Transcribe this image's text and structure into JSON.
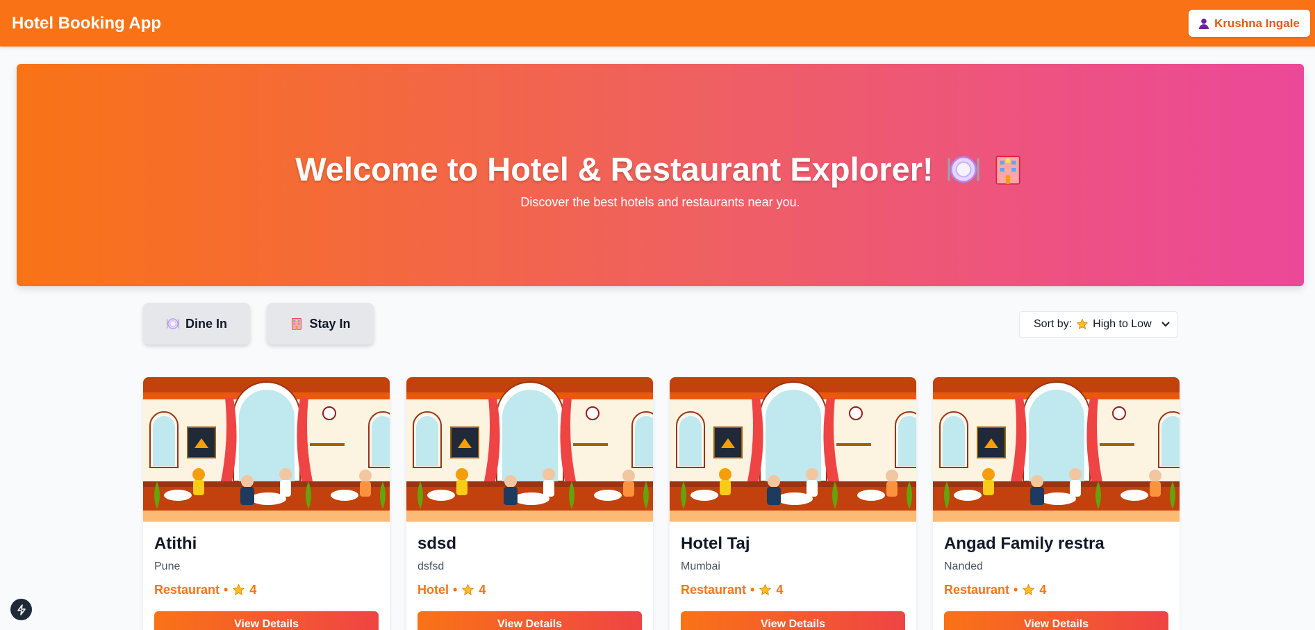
{
  "navbar": {
    "brand": "Hotel Booking App",
    "user_name": "Krushna Ingale",
    "user_icon": "user-icon"
  },
  "hero": {
    "title": "Welcome to Hotel & Restaurant Explorer!",
    "title_emojis": [
      "plate-cutlery-icon",
      "hotel-icon"
    ],
    "subtitle": "Discover the best hotels and restaurants near you."
  },
  "filters": [
    {
      "label": "Dine In",
      "icon": "plate-cutlery-icon"
    },
    {
      "label": "Stay In",
      "icon": "hotel-icon"
    }
  ],
  "sort": {
    "prefix": "Sort by:",
    "selected": "High to Low",
    "icon": "star-icon"
  },
  "listings": [
    {
      "name": "Atithi",
      "location": "Pune",
      "type": "Restaurant",
      "rating": "4",
      "button": "View Details"
    },
    {
      "name": "sdsd",
      "location": "dsfsd",
      "type": "Hotel",
      "rating": "4",
      "button": "View Details"
    },
    {
      "name": "Hotel Taj",
      "location": "Mumbai",
      "type": "Restaurant",
      "rating": "4",
      "button": "View Details"
    },
    {
      "name": "Angad Family restra",
      "location": "Nanded",
      "type": "Restaurant",
      "rating": "4",
      "button": "View Details"
    }
  ],
  "colors": {
    "primary": "#f97316",
    "accent_pink": "#ec4899",
    "button_end": "#ef4444"
  }
}
